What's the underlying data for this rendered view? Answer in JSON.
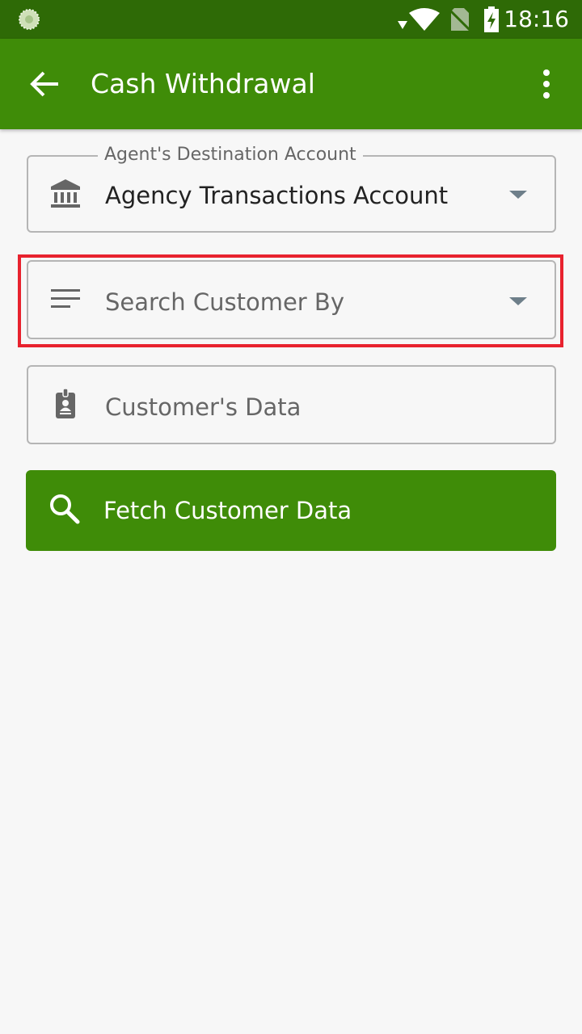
{
  "status_bar": {
    "time": "18:16",
    "icons": [
      "app-notification-icon",
      "wifi-icon",
      "no-sim-icon",
      "battery-charging-icon"
    ]
  },
  "app_bar": {
    "title": "Cash Withdrawal",
    "back_icon": "arrow-back-icon",
    "menu_icon": "more-vert-icon"
  },
  "form": {
    "destination_account": {
      "label": "Agent's Destination Account",
      "value": "Agency Transactions Account",
      "icon": "bank-icon"
    },
    "search_by": {
      "placeholder": "Search Customer By",
      "icon": "sort-lines-icon"
    },
    "customer_data": {
      "placeholder": "Customer's Data",
      "icon": "id-badge-icon"
    },
    "fetch_button": {
      "label": "Fetch Customer Data",
      "icon": "search-icon"
    }
  },
  "colors": {
    "status_bar": "#2e6a06",
    "primary": "#3f8c08",
    "background": "#f7f7f7",
    "highlight": "#e8222e"
  }
}
